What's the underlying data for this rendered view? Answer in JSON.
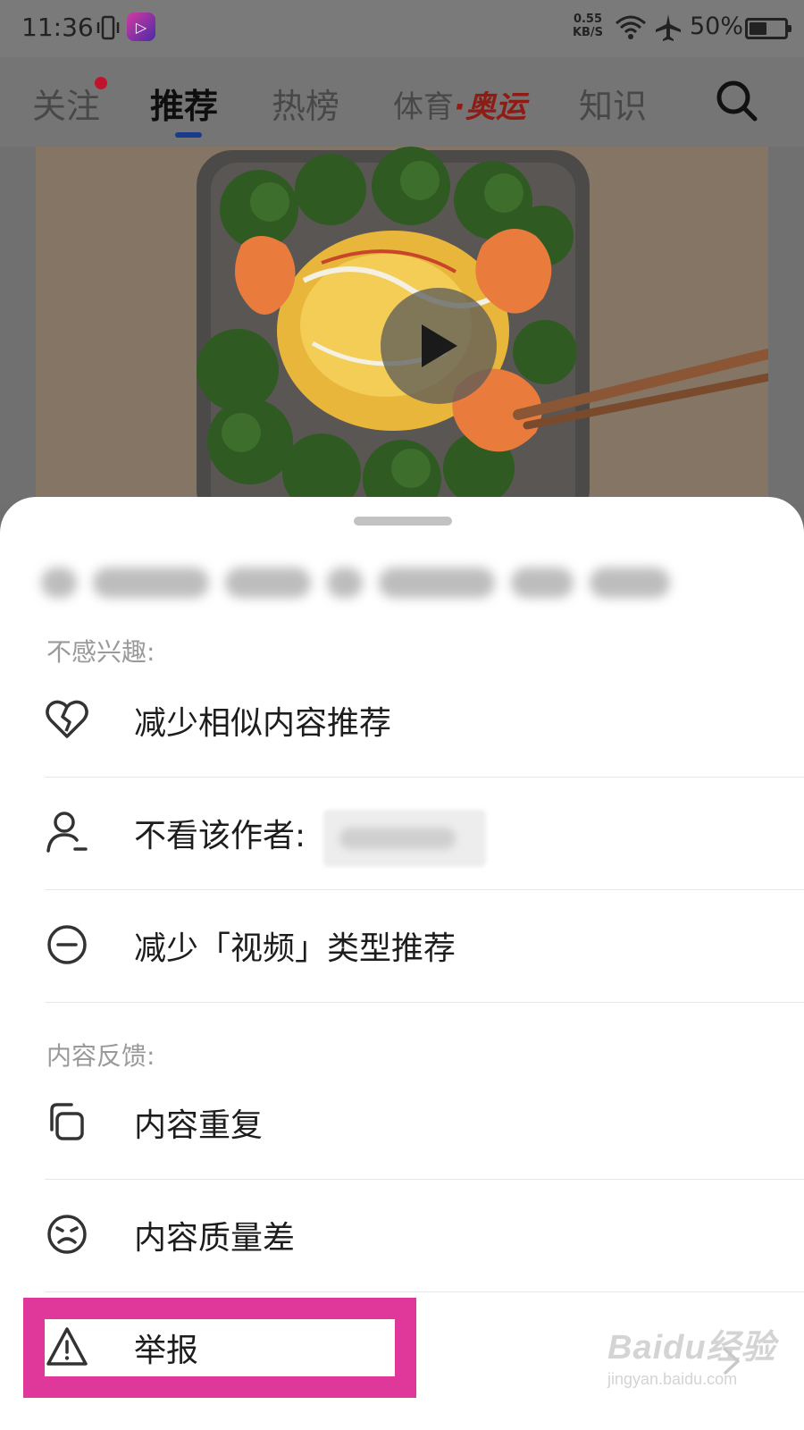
{
  "status_bar": {
    "time": "11:36",
    "net_speed": "0.55 KB/S",
    "battery_pct": "50%",
    "battery_level": 0.5
  },
  "nav_tabs": [
    {
      "label": "关注",
      "has_dot": true
    },
    {
      "label": "推荐",
      "active": true
    },
    {
      "label": "热榜"
    },
    {
      "label": "体育",
      "suffix": "·奥运"
    },
    {
      "label": "知识"
    }
  ],
  "sheet": {
    "section_not_interested": "不感兴趣:",
    "rows_not_interested": [
      {
        "label": "减少相似内容推荐",
        "icon": "broken-heart-icon"
      },
      {
        "label": "不看该作者:",
        "icon": "user-minus-icon"
      },
      {
        "label": "减少「视频」类型推荐",
        "icon": "minus-circle-icon"
      }
    ],
    "section_feedback": "内容反馈:",
    "rows_feedback": [
      {
        "label": "内容重复",
        "icon": "duplicate-icon"
      },
      {
        "label": "内容质量差",
        "icon": "sad-face-icon"
      },
      {
        "label": "举报",
        "icon": "warning-icon"
      }
    ]
  },
  "watermark": {
    "logo": "Baidu经验",
    "url": "jingyan.baidu.com"
  },
  "colors": {
    "highlight": "#e0389a",
    "active_underline": "#1a3a8c",
    "olympic_red": "#c0281c"
  }
}
